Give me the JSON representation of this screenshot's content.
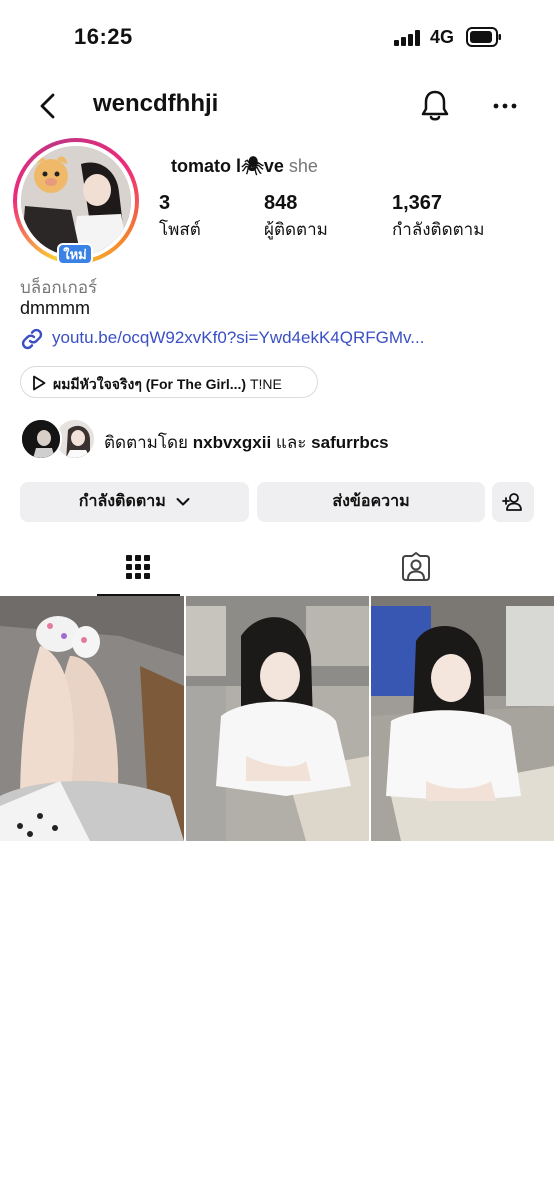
{
  "status_bar": {
    "time": "16:25",
    "network": "4G"
  },
  "header": {
    "username": "wencdfhhji",
    "back_icon": "chevron-left-icon",
    "bell_icon": "bell-icon",
    "more_icon": "more-horizontal-icon"
  },
  "profile": {
    "display_name": "tomato l🕷ve",
    "pronoun": "she",
    "new_badge": "ใหม่",
    "stats": [
      {
        "value": "3",
        "label": "โพสต์"
      },
      {
        "value": "848",
        "label": "ผู้ติดตาม"
      },
      {
        "value": "1,367",
        "label": "กำลังติดตาม"
      }
    ],
    "category": "บล็อกเกอร์",
    "bio": "dmmmm",
    "link": "youtu.be/ocqW92xvKf0?si=Ywd4ekK4QRFGMv...",
    "music": {
      "title": "ผมมีหัวใจจริงๆ (For The Girl...)",
      "artist": "T!NE"
    },
    "followed_by": {
      "prefix": "ติดตามโดย",
      "user1": "nxbvxgxii",
      "conj": "และ",
      "user2": "safurrbcs"
    }
  },
  "actions": {
    "following": "กำลังติดตาม",
    "message": "ส่งข้อความ"
  },
  "colors": {
    "link": "#3b4fc4",
    "badge": "#3b82e6",
    "button_bg": "#efeff1"
  }
}
